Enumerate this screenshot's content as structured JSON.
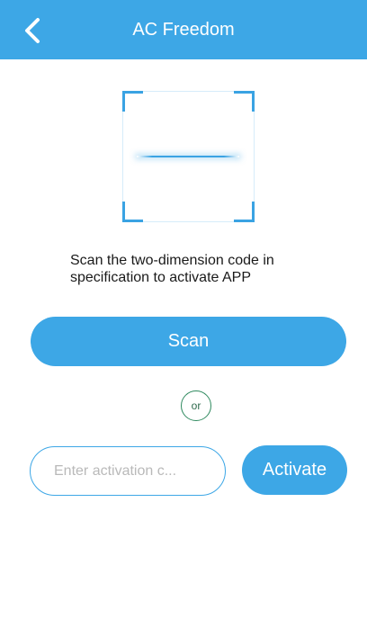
{
  "header": {
    "title": "AC Freedom",
    "back_icon": "chevron-left-icon"
  },
  "scanner": {
    "instructions": "Scan the two-dimension code in specification to activate APP"
  },
  "actions": {
    "scan_label": "Scan",
    "or_label": "or",
    "activation_placeholder": "Enter activation c...",
    "activation_value": "",
    "activate_label": "Activate"
  },
  "colors": {
    "accent": "#3da7e6",
    "or_circle_border": "#2f8a5f"
  }
}
